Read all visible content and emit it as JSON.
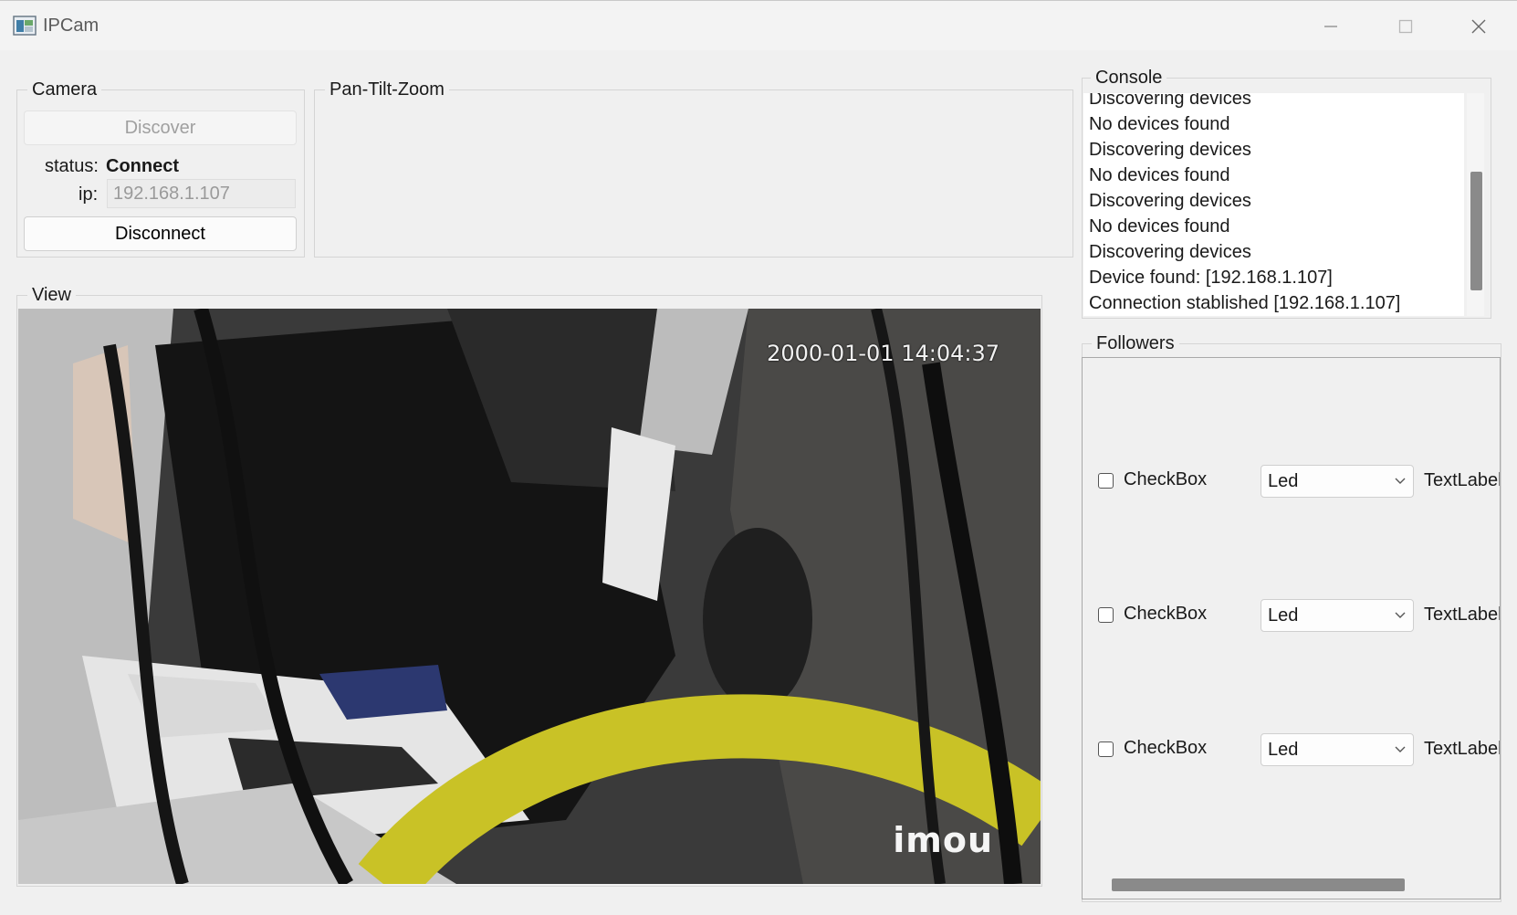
{
  "window": {
    "title": "IPCam"
  },
  "camera": {
    "legend": "Camera",
    "discover_label": "Discover",
    "status_label": "status:",
    "status_value": "Connect",
    "ip_label": "ip:",
    "ip_value": "192.168.1.107",
    "disconnect_label": "Disconnect"
  },
  "ptz": {
    "legend": "Pan-Tilt-Zoom"
  },
  "view": {
    "legend": "View",
    "timestamp": "2000-01-01 14:04:37",
    "watermark": "imou"
  },
  "console": {
    "legend": "Console",
    "lines": [
      "Discovering devices",
      "No devices found",
      "Discovering devices",
      "No devices found",
      "Discovering devices",
      "No devices found",
      "Discovering devices",
      "Device found: [192.168.1.107]",
      "Connection stablished [192.168.1.107]"
    ]
  },
  "followers": {
    "legend": "Followers",
    "rows": [
      {
        "checkbox_label": "CheckBox",
        "combo_value": "Led",
        "text_label": "TextLabel"
      },
      {
        "checkbox_label": "CheckBox",
        "combo_value": "Led",
        "text_label": "TextLabel"
      },
      {
        "checkbox_label": "CheckBox",
        "combo_value": "Led",
        "text_label": "TextLabel"
      }
    ]
  },
  "icons": {
    "app": "app-window-icon",
    "minimize": "minimize-icon",
    "maximize": "maximize-icon",
    "close": "close-icon",
    "combo_arrow": "chevron-down-icon"
  }
}
